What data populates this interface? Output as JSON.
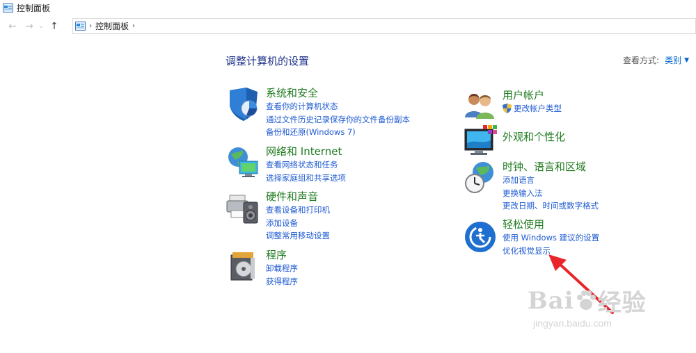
{
  "window": {
    "title": "控制面板"
  },
  "nav": {
    "back": "←",
    "forward": "→",
    "dropdown": "⌄",
    "up": "↑"
  },
  "address": {
    "separator": "›",
    "crumb": "控制面板",
    "trailing_separator": "›"
  },
  "header": {
    "title": "调整计算机的设置",
    "view_by_label": "查看方式:",
    "view_by_value": "类别",
    "view_by_caret": "▼"
  },
  "left_categories": [
    {
      "title": "系统和安全",
      "icon": "shield-icon",
      "links": [
        "查看你的计算机状态",
        "通过文件历史记录保存你的文件备份副本",
        "备份和还原(Windows 7)"
      ]
    },
    {
      "title": "网络和 Internet",
      "icon": "network-globe-icon",
      "links": [
        "查看网络状态和任务",
        "选择家庭组和共享选项"
      ]
    },
    {
      "title": "硬件和声音",
      "icon": "printer-speaker-icon",
      "links": [
        "查看设备和打印机",
        "添加设备",
        "调整常用移动设置"
      ]
    },
    {
      "title": "程序",
      "icon": "programs-disc-icon",
      "links": [
        "卸载程序",
        "获得程序"
      ]
    }
  ],
  "right_categories": [
    {
      "title": "用户帐户",
      "icon": "users-icon",
      "links": [
        "更改帐户类型"
      ]
    },
    {
      "title": "外观和个性化",
      "icon": "monitor-palette-icon",
      "links": []
    },
    {
      "title": "时钟、语言和区域",
      "icon": "clock-globe-icon",
      "links": [
        "添加语言",
        "更换输入法",
        "更改日期、时间或数字格式"
      ]
    },
    {
      "title": "轻松使用",
      "icon": "ease-of-access-icon",
      "links": [
        "使用 Windows 建议的设置",
        "优化视觉显示"
      ]
    }
  ],
  "watermark": {
    "brand": "Bai",
    "brand_cn": "经验",
    "sub": "jingyan.baidu.com"
  },
  "colors": {
    "heading": "#1e3287",
    "category_title": "#1e7a1e",
    "link": "#1e5ad2",
    "arrow": "#e8262a"
  }
}
